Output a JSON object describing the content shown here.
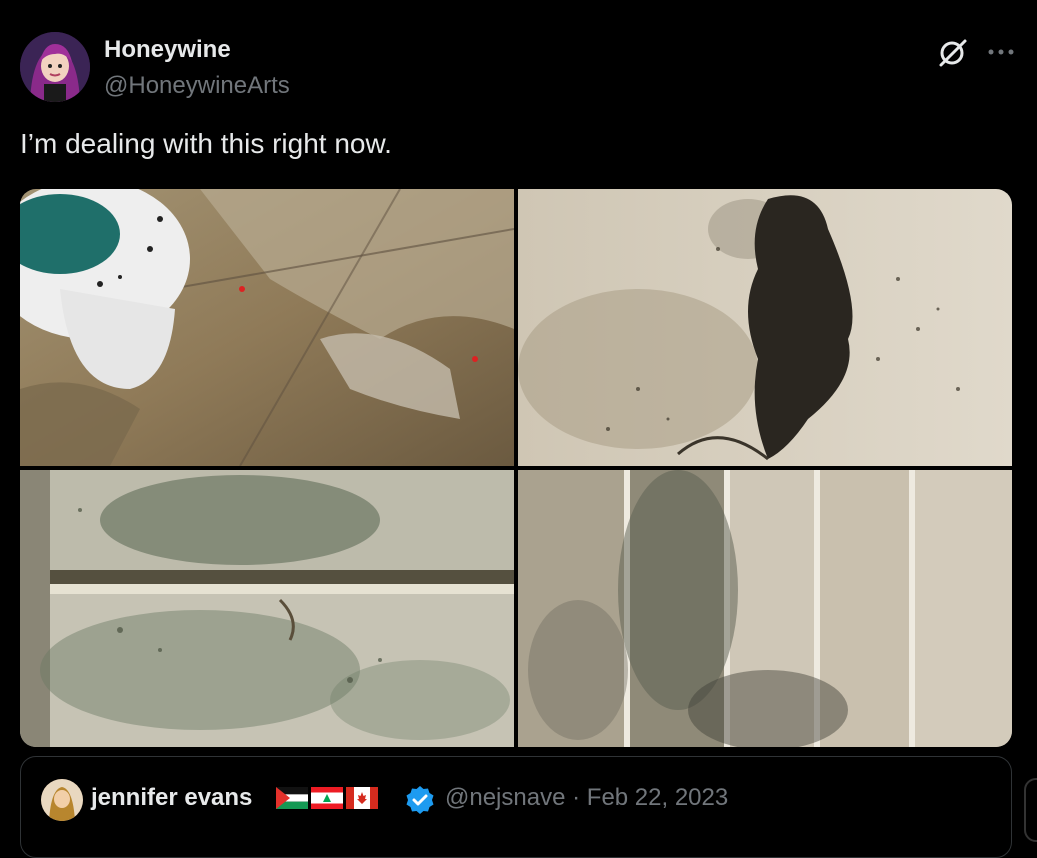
{
  "author": {
    "display_name": "Honeywine",
    "handle": "@HoneywineArts"
  },
  "tweet": {
    "text": "I’m dealing with this right now."
  },
  "media": {
    "photos": [
      {
        "name": "photo-toilet-floor"
      },
      {
        "name": "photo-wall-black-mold"
      },
      {
        "name": "photo-door-mold"
      },
      {
        "name": "photo-panel-wall-mold"
      }
    ]
  },
  "quote": {
    "display_name": "jennifer evans",
    "handle": "@nejsnave",
    "separator": "·",
    "date": "Feb 22, 2023",
    "flags": [
      "palestine-flag",
      "lebanon-flag",
      "canada-flag"
    ]
  },
  "icons": {
    "grok": "grok-icon",
    "more": "more-icon",
    "verified": "verified-badge-icon"
  },
  "colors": {
    "background": "#000000",
    "primary_text": "#e7e9ea",
    "secondary_text": "#71767b",
    "verified_blue": "#1d9bf0",
    "border": "#2f3336"
  }
}
